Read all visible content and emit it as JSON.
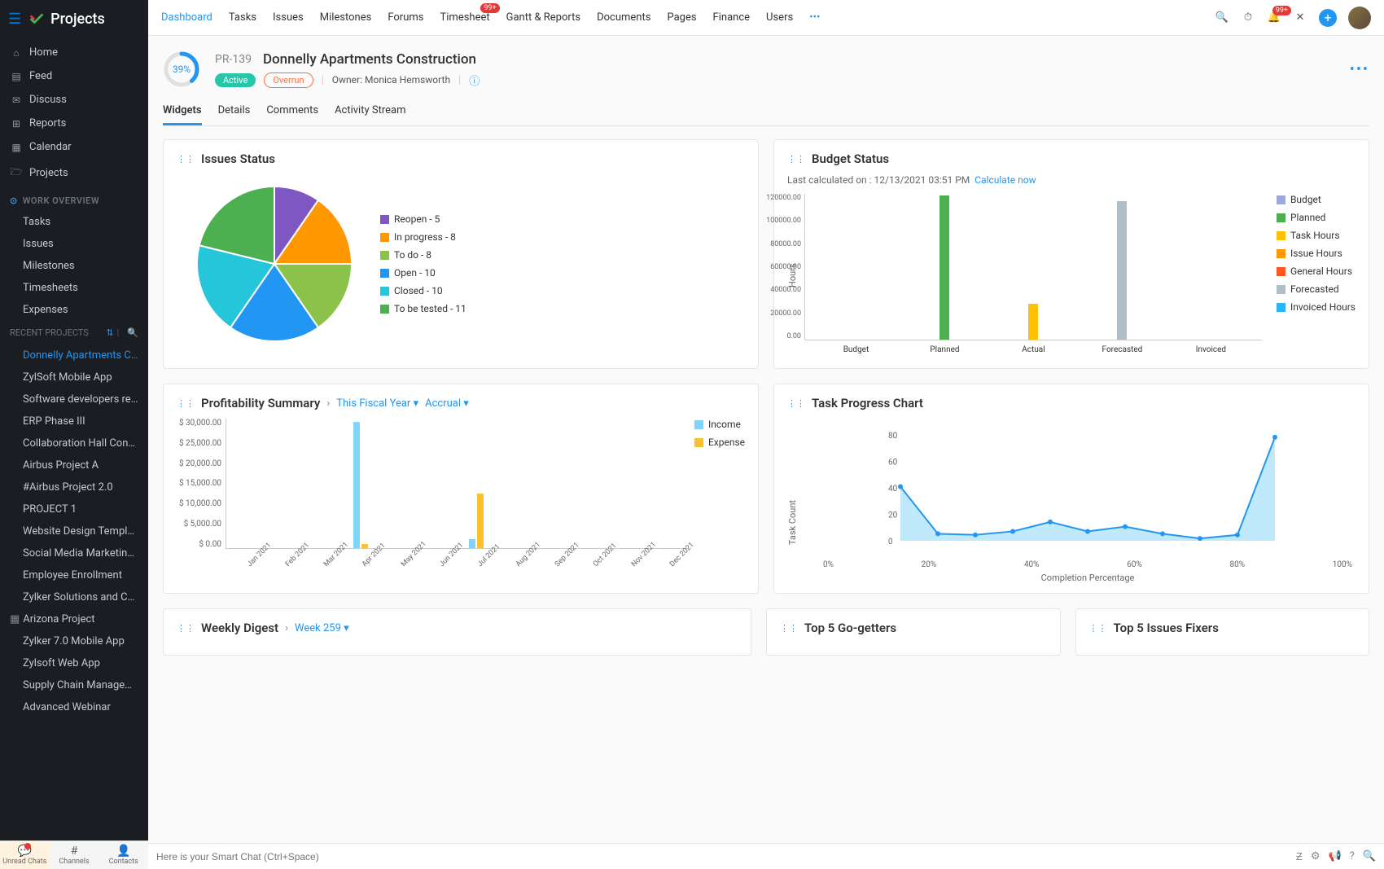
{
  "sidebar": {
    "app_name": "Projects",
    "nav_items": [
      {
        "icon": "⌂",
        "label": "Home"
      },
      {
        "icon": "▤",
        "label": "Feed"
      },
      {
        "icon": "✉",
        "label": "Discuss"
      },
      {
        "icon": "⊞",
        "label": "Reports"
      },
      {
        "icon": "▦",
        "label": "Calendar"
      },
      {
        "icon": "🗁",
        "label": "Projects"
      }
    ],
    "section_work": "WORK OVERVIEW",
    "work_items": [
      "Tasks",
      "Issues",
      "Milestones",
      "Timesheets",
      "Expenses"
    ],
    "section_recent": "RECENT PROJECTS",
    "recent_items": [
      "Donnelly Apartments C...",
      "ZylSoft Mobile App",
      "Software developers re...",
      "ERP Phase III",
      "Collaboration Hall Cons...",
      "Airbus Project A",
      "#Airbus Project 2.0",
      "PROJECT 1",
      "Website Design Templa...",
      "Social Media Marketing...",
      "Employee Enrollment",
      "Zylker Solutions and Co...",
      "Arizona Project",
      "Zylker 7.0 Mobile App",
      "Zylsoft Web App",
      "Supply Chain Managem...",
      "Advanced Webinar"
    ],
    "bottom_tabs": [
      "Unread Chats",
      "Channels",
      "Contacts"
    ]
  },
  "topnav": {
    "items": [
      "Dashboard",
      "Tasks",
      "Issues",
      "Milestones",
      "Forums",
      "Timesheet",
      "Gantt & Reports",
      "Documents",
      "Pages",
      "Finance",
      "Users"
    ],
    "badge_timesheet": "99+",
    "badge_bell": "99+"
  },
  "project": {
    "progress": "39%",
    "id": "PR-139",
    "name": "Donnelly Apartments Construction",
    "status_active": "Active",
    "status_overrun": "Overrun",
    "owner_label": "Owner:",
    "owner_name": "Monica Hemsworth"
  },
  "subtabs": [
    "Widgets",
    "Details",
    "Comments",
    "Activity Stream"
  ],
  "issues_widget": {
    "title": "Issues Status",
    "legend": [
      {
        "color": "#7e57c2",
        "label": "Reopen - 5"
      },
      {
        "color": "#ff9800",
        "label": "In progress - 8"
      },
      {
        "color": "#8bc34a",
        "label": "To do - 8"
      },
      {
        "color": "#2196f3",
        "label": "Open - 10"
      },
      {
        "color": "#26c6da",
        "label": "Closed - 10"
      },
      {
        "color": "#4caf50",
        "label": "To be tested - 11"
      }
    ]
  },
  "budget_widget": {
    "title": "Budget Status",
    "subtext_prefix": "Last calculated on : ",
    "subtext_date": "12/13/2021 03:51 PM",
    "calc_link": "Calculate now",
    "y_label": "Hours",
    "legend": [
      {
        "color": "#9fa8da",
        "label": "Budget"
      },
      {
        "color": "#4caf50",
        "label": "Planned"
      },
      {
        "color": "#ffc107",
        "label": "Task Hours"
      },
      {
        "color": "#ff9800",
        "label": "Issue Hours"
      },
      {
        "color": "#ff5722",
        "label": "General Hours"
      },
      {
        "color": "#b0bec5",
        "label": "Forecasted"
      },
      {
        "color": "#29b6f6",
        "label": "Invoiced Hours"
      }
    ]
  },
  "profit_widget": {
    "title": "Profitability Summary",
    "dd1": "This Fiscal Year",
    "dd2": "Accrual",
    "legend": [
      {
        "color": "#81d4fa",
        "label": "Income"
      },
      {
        "color": "#fbc02d",
        "label": "Expense"
      }
    ]
  },
  "task_widget": {
    "title": "Task Progress Chart",
    "y_label": "Task Count",
    "x_label": "Completion Percentage"
  },
  "weekly_widget": {
    "title": "Weekly Digest",
    "week": "Week 259"
  },
  "gogetters_widget": {
    "title": "Top 5 Go-getters"
  },
  "fixers_widget": {
    "title": "Top 5 Issues Fixers"
  },
  "chat": {
    "placeholder": "Here is your Smart Chat (Ctrl+Space)"
  },
  "chart_data": [
    {
      "type": "pie",
      "title": "Issues Status",
      "series": [
        {
          "name": "Reopen",
          "value": 5,
          "color": "#7e57c2"
        },
        {
          "name": "In progress",
          "value": 8,
          "color": "#ff9800"
        },
        {
          "name": "To do",
          "value": 8,
          "color": "#8bc34a"
        },
        {
          "name": "Open",
          "value": 10,
          "color": "#2196f3"
        },
        {
          "name": "Closed",
          "value": 10,
          "color": "#26c6da"
        },
        {
          "name": "To be tested",
          "value": 11,
          "color": "#4caf50"
        }
      ]
    },
    {
      "type": "bar",
      "title": "Budget Status",
      "ylabel": "Hours",
      "ylim": [
        0,
        130000
      ],
      "y_ticks": [
        "120000.00",
        "100000.00",
        "80000.00",
        "60000.00",
        "40000.00",
        "20000.00",
        "0.00"
      ],
      "categories": [
        "Budget",
        "Planned",
        "Actual",
        "Forecasted",
        "Invoiced"
      ],
      "values": [
        0,
        128000,
        32000,
        123000,
        0
      ],
      "colors": [
        "#9fa8da",
        "#4caf50",
        "#ffc107",
        "#b0bec5",
        "#29b6f6"
      ]
    },
    {
      "type": "bar",
      "title": "Profitability Summary",
      "ylim": [
        0,
        30000
      ],
      "y_ticks": [
        "$ 30,000.00",
        "$ 25,000.00",
        "$ 20,000.00",
        "$ 15,000.00",
        "$ 10,000.00",
        "$ 5,000.00",
        "$ 0.00"
      ],
      "categories": [
        "Jan 2021",
        "Feb 2021",
        "Mar 2021",
        "Apr 2021",
        "May 2021",
        "Jun 2021",
        "Jul 2021",
        "Aug 2021",
        "Sep 2021",
        "Oct 2021",
        "Nov 2021",
        "Dec 2021"
      ],
      "series": [
        {
          "name": "Income",
          "color": "#81d4fa",
          "values": [
            0,
            0,
            0,
            29000,
            0,
            0,
            2000,
            0,
            0,
            0,
            0,
            0
          ]
        },
        {
          "name": "Expense",
          "color": "#fbc02d",
          "values": [
            0,
            0,
            0,
            1000,
            0,
            0,
            12500,
            0,
            0,
            0,
            0,
            0
          ]
        }
      ]
    },
    {
      "type": "area",
      "title": "Task Progress Chart",
      "xlabel": "Completion Percentage",
      "ylabel": "Task Count",
      "ylim": [
        0,
        90
      ],
      "y_ticks": [
        "80",
        "60",
        "40",
        "20",
        "0"
      ],
      "x": [
        0,
        10,
        20,
        30,
        40,
        50,
        60,
        70,
        80,
        90,
        100
      ],
      "x_ticks": [
        "0%",
        "20%",
        "40%",
        "60%",
        "80%",
        "100%"
      ],
      "values": [
        46,
        6,
        5,
        8,
        16,
        8,
        12,
        6,
        2,
        5,
        88
      ]
    }
  ]
}
